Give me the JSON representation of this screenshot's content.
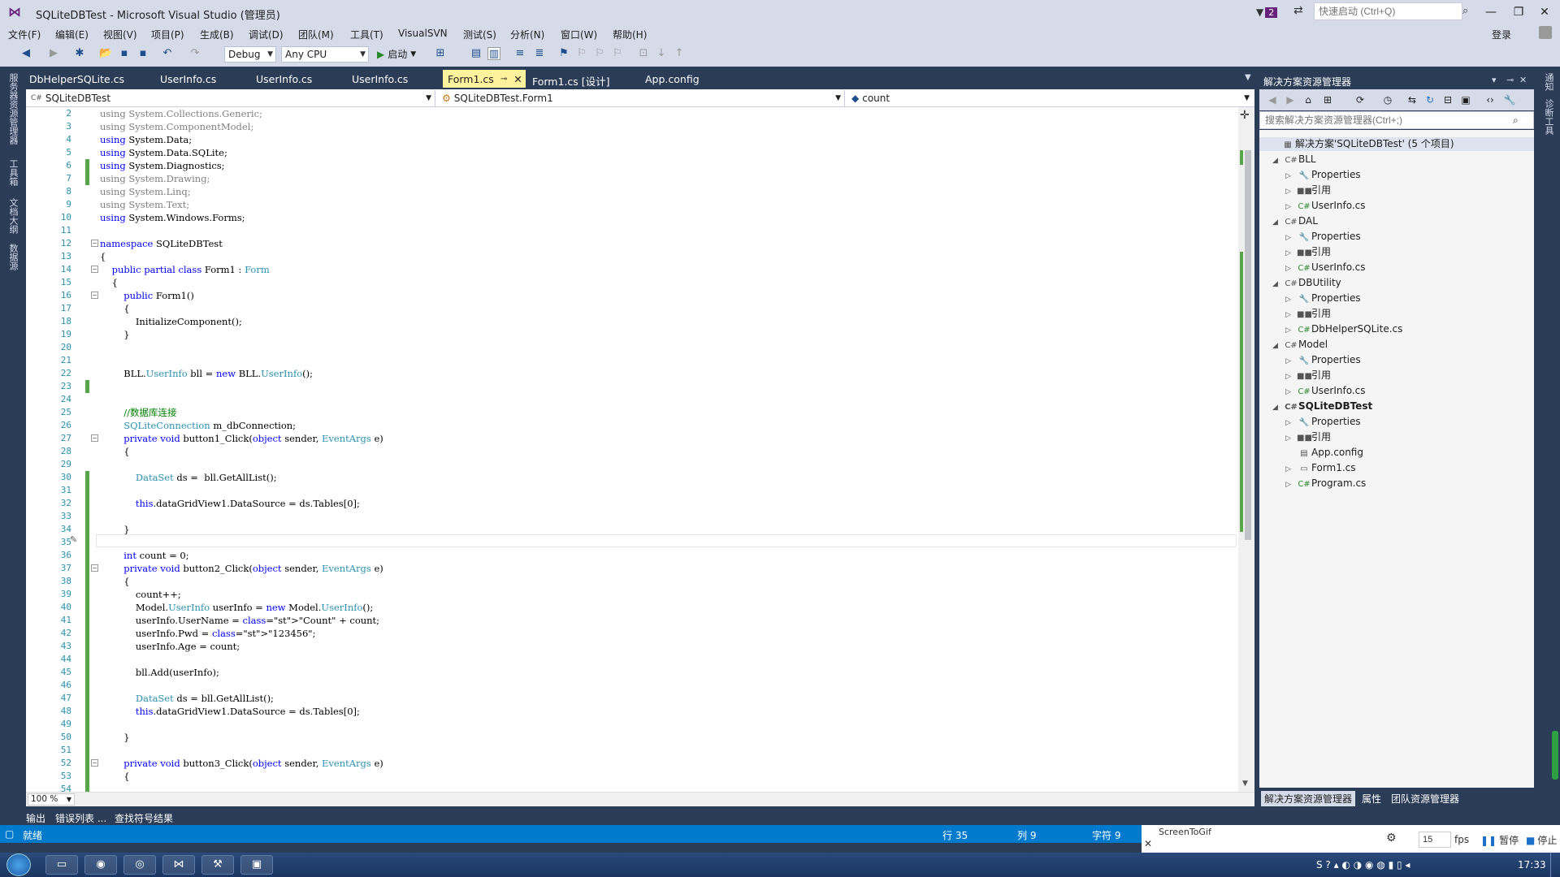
{
  "window": {
    "title": "SQLiteDBTest - Microsoft Visual Studio (管理员)",
    "notification_count": "2",
    "quick_launch_placeholder": "快速启动 (Ctrl+Q)",
    "login": "登录"
  },
  "menu": [
    "文件(F)",
    "编辑(E)",
    "视图(V)",
    "项目(P)",
    "生成(B)",
    "调试(D)",
    "团队(M)",
    "工具(T)",
    "VisualSVN",
    "测试(S)",
    "分析(N)",
    "窗口(W)",
    "帮助(H)"
  ],
  "toolbar": {
    "config": "Debug",
    "platform": "Any CPU",
    "start_label": "启动"
  },
  "left_tool_tabs": [
    "服务器资源管理器",
    "工具箱",
    "文档大纲",
    "数据源"
  ],
  "right_tool_tabs": [
    "通知",
    "诊断工具"
  ],
  "doc_tabs": [
    "DbHelperSQLite.cs",
    "UserInfo.cs",
    "UserInfo.cs",
    "UserInfo.cs",
    "Form1.cs",
    "Form1.cs [设计]",
    "App.config"
  ],
  "active_tab_index": 4,
  "nav": {
    "project": "SQLiteDBTest",
    "class": "SQLiteDBTest.Form1",
    "member": "count"
  },
  "code_lines": [
    {
      "n": "2",
      "t": "using System.Collections.Generic;",
      "dim": true
    },
    {
      "n": "3",
      "t": "using System.ComponentModel;",
      "dim": true
    },
    {
      "n": "4",
      "t": "using System.Data;"
    },
    {
      "n": "5",
      "t": "using System.Data.SQLite;"
    },
    {
      "n": "6",
      "t": "using System.Diagnostics;"
    },
    {
      "n": "7",
      "t": "using System.Drawing;",
      "dim": true
    },
    {
      "n": "8",
      "t": "using System.Linq;",
      "dim": true
    },
    {
      "n": "9",
      "t": "using System.Text;",
      "dim": true
    },
    {
      "n": "10",
      "t": "using System.Windows.Forms;"
    },
    {
      "n": "11",
      "t": ""
    },
    {
      "n": "12",
      "t": "namespace SQLiteDBTest"
    },
    {
      "n": "13",
      "t": "{"
    },
    {
      "n": "14",
      "t": "    public partial class Form1 : Form"
    },
    {
      "n": "15",
      "t": "    {"
    },
    {
      "n": "16",
      "t": "        public Form1()"
    },
    {
      "n": "17",
      "t": "        {"
    },
    {
      "n": "18",
      "t": "            InitializeComponent();"
    },
    {
      "n": "19",
      "t": "        }"
    },
    {
      "n": "20",
      "t": ""
    },
    {
      "n": "21",
      "t": ""
    },
    {
      "n": "22",
      "t": "        BLL.UserInfo bll = new BLL.UserInfo();"
    },
    {
      "n": "23",
      "t": ""
    },
    {
      "n": "24",
      "t": ""
    },
    {
      "n": "25",
      "t": "        //数据库连接"
    },
    {
      "n": "26",
      "t": "        SQLiteConnection m_dbConnection;"
    },
    {
      "n": "27",
      "t": "        private void button1_Click(object sender, EventArgs e)"
    },
    {
      "n": "28",
      "t": "        {"
    },
    {
      "n": "29",
      "t": ""
    },
    {
      "n": "30",
      "t": "            DataSet ds =  bll.GetAllList();"
    },
    {
      "n": "31",
      "t": ""
    },
    {
      "n": "32",
      "t": "            this.dataGridView1.DataSource = ds.Tables[0];"
    },
    {
      "n": "33",
      "t": ""
    },
    {
      "n": "34",
      "t": "        }"
    },
    {
      "n": "35",
      "t": ""
    },
    {
      "n": "36",
      "t": "        int count = 0;"
    },
    {
      "n": "37",
      "t": "        private void button2_Click(object sender, EventArgs e)"
    },
    {
      "n": "38",
      "t": "        {"
    },
    {
      "n": "39",
      "t": "            count++;"
    },
    {
      "n": "40",
      "t": "            Model.UserInfo userInfo = new Model.UserInfo();"
    },
    {
      "n": "41",
      "t": "            userInfo.UserName = \"Count\" + count;"
    },
    {
      "n": "42",
      "t": "            userInfo.Pwd = \"123456\";"
    },
    {
      "n": "43",
      "t": "            userInfo.Age = count;"
    },
    {
      "n": "44",
      "t": ""
    },
    {
      "n": "45",
      "t": "            bll.Add(userInfo);"
    },
    {
      "n": "46",
      "t": ""
    },
    {
      "n": "47",
      "t": "            DataSet ds = bll.GetAllList();"
    },
    {
      "n": "48",
      "t": "            this.dataGridView1.DataSource = ds.Tables[0];"
    },
    {
      "n": "49",
      "t": ""
    },
    {
      "n": "50",
      "t": "        }"
    },
    {
      "n": "51",
      "t": ""
    },
    {
      "n": "52",
      "t": "        private void button3_Click(object sender, EventArgs e)"
    },
    {
      "n": "53",
      "t": "        {"
    },
    {
      "n": "54",
      "t": ""
    }
  ],
  "editor": {
    "zoom": "100 %"
  },
  "bottom_tabs": [
    "输出",
    "错误列表 ...",
    "查找符号结果"
  ],
  "solution_explorer": {
    "title": "解决方案资源管理器",
    "search_placeholder": "搜索解决方案资源管理器(Ctrl+;)",
    "tree": [
      {
        "label": "解决方案'SQLiteDBTest' (5 个项目)",
        "depth": 0,
        "icon": "solution-icon",
        "exp": ""
      },
      {
        "label": "BLL",
        "depth": 1,
        "icon": "csproj-icon",
        "exp": "◢"
      },
      {
        "label": "Properties",
        "depth": 2,
        "icon": "wrench-icon",
        "exp": "▷"
      },
      {
        "label": "引用",
        "depth": 2,
        "icon": "references-icon",
        "exp": "▷"
      },
      {
        "label": "UserInfo.cs",
        "depth": 2,
        "icon": "csfile-icon",
        "exp": "▷"
      },
      {
        "label": "DAL",
        "depth": 1,
        "icon": "csproj-icon",
        "exp": "◢"
      },
      {
        "label": "Properties",
        "depth": 2,
        "icon": "wrench-icon",
        "exp": "▷"
      },
      {
        "label": "引用",
        "depth": 2,
        "icon": "references-icon",
        "exp": "▷"
      },
      {
        "label": "UserInfo.cs",
        "depth": 2,
        "icon": "csfile-icon",
        "exp": "▷"
      },
      {
        "label": "DBUtility",
        "depth": 1,
        "icon": "csproj-icon",
        "exp": "◢"
      },
      {
        "label": "Properties",
        "depth": 2,
        "icon": "wrench-icon",
        "exp": "▷"
      },
      {
        "label": "引用",
        "depth": 2,
        "icon": "references-icon",
        "exp": "▷"
      },
      {
        "label": "DbHelperSQLite.cs",
        "depth": 2,
        "icon": "csfile-icon",
        "exp": "▷"
      },
      {
        "label": "Model",
        "depth": 1,
        "icon": "csproj-icon",
        "exp": "◢"
      },
      {
        "label": "Properties",
        "depth": 2,
        "icon": "wrench-icon",
        "exp": "▷"
      },
      {
        "label": "引用",
        "depth": 2,
        "icon": "references-icon",
        "exp": "▷"
      },
      {
        "label": "UserInfo.cs",
        "depth": 2,
        "icon": "csfile-icon",
        "exp": "▷"
      },
      {
        "label": "SQLiteDBTest",
        "depth": 1,
        "icon": "csproj-icon",
        "exp": "◢",
        "bold": true
      },
      {
        "label": "Properties",
        "depth": 2,
        "icon": "wrench-icon",
        "exp": "▷"
      },
      {
        "label": "引用",
        "depth": 2,
        "icon": "references-icon",
        "exp": "▷"
      },
      {
        "label": "App.config",
        "depth": 2,
        "icon": "config-icon",
        "exp": ""
      },
      {
        "label": "Form1.cs",
        "depth": 2,
        "icon": "form-icon",
        "exp": "▷"
      },
      {
        "label": "Program.cs",
        "depth": 2,
        "icon": "csfile-icon",
        "exp": "▷"
      }
    ],
    "bottom_tabs": [
      "解决方案资源管理器",
      "属性",
      "团队资源管理器"
    ]
  },
  "status": {
    "ready": "就绪",
    "line": "行 35",
    "col": "列 9",
    "ch": "字符 9"
  },
  "screentogif": {
    "title": "ScreenToGif",
    "fps_value": "15",
    "fps_label": "fps",
    "pause": "暂停",
    "stop": "停止"
  },
  "taskbar": {
    "clock": "17:33"
  },
  "colors": {
    "accent": "#007acc",
    "active_tab": "#fff29d",
    "change_marker": "#57a64a"
  }
}
